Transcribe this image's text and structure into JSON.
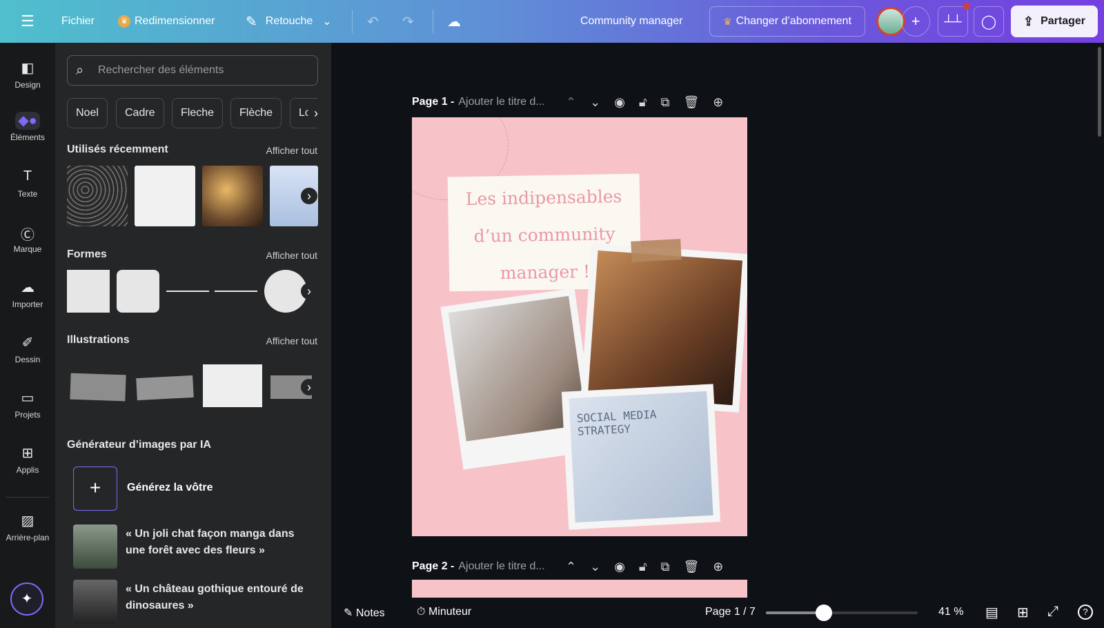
{
  "topbar": {
    "menu_icon": "hamburger-icon",
    "file": "Fichier",
    "resize": "Redimensionner",
    "edit": "Retouche",
    "title": "Community manager",
    "upgrade": "Changer d’abonnement",
    "share": "Partager",
    "colors": {
      "gradient_start": "#4fbfcd",
      "gradient_end": "#7540e0"
    }
  },
  "rail": [
    {
      "label": "Design",
      "icon": "layout-icon"
    },
    {
      "label": "Éléments",
      "icon": "shapes-icon"
    },
    {
      "label": "Texte",
      "icon": "text-icon"
    },
    {
      "label": "Marque",
      "icon": "brand-icon"
    },
    {
      "label": "Importer",
      "icon": "upload-cloud-icon"
    },
    {
      "label": "Dessin",
      "icon": "pen-icon"
    },
    {
      "label": "Projets",
      "icon": "folder-icon"
    },
    {
      "label": "Applis",
      "icon": "apps-icon"
    },
    {
      "label": "Arrière-plan",
      "icon": "background-icon"
    }
  ],
  "panel": {
    "search_placeholder": "Rechercher des éléments",
    "chips": [
      "Noel",
      "Cadre",
      "Fleche",
      "Flèche",
      "Logo"
    ],
    "recent": {
      "title": "Utilisés récemment",
      "see_all": "Afficher tout"
    },
    "shapes": {
      "title": "Formes",
      "see_all": "Afficher tout"
    },
    "illustrations": {
      "title": "Illustrations",
      "see_all": "Afficher tout"
    },
    "ai": {
      "title": "Générateur d’images par IA",
      "generate": "Générez la vôtre",
      "prompts": [
        "« Un joli chat façon manga dans une forêt avec des fleurs »",
        "« Un château gothique entouré de dinosaures »"
      ]
    }
  },
  "canvas": {
    "page1": {
      "label": "Page 1 -",
      "title_placeholder": "Ajouter le titre d...",
      "design_text": [
        "Les indipensables",
        "d’un community",
        "manager !"
      ],
      "photo_text": "SOCIAL MEDIA STRATEGY"
    },
    "page2": {
      "label": "Page 2 -",
      "title_placeholder": "Ajouter le titre d..."
    },
    "page_color": "#f7c3c8"
  },
  "bottom": {
    "notes": "Notes",
    "timer": "Minuteur",
    "page_indicator": "Page 1 / 7",
    "zoom": "41 %",
    "zoom_fraction": 0.38
  }
}
